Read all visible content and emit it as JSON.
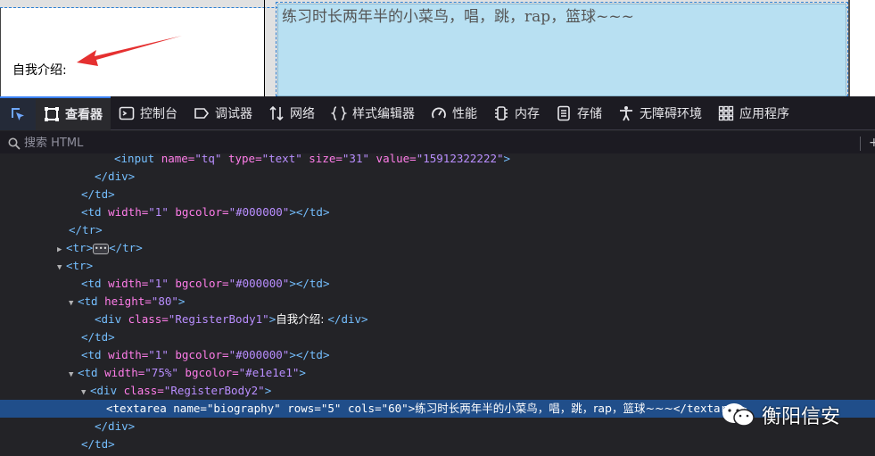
{
  "preview": {
    "intro_label": "自我介绍:",
    "textarea_value": "练习时长两年半的小菜鸟，唱，跳，rap，篮球~~~"
  },
  "toolbar": {
    "tabs": [
      {
        "label": "查看器",
        "icon": "inspector-icon",
        "active": true
      },
      {
        "label": "控制台",
        "icon": "console-icon"
      },
      {
        "label": "调试器",
        "icon": "debugger-icon"
      },
      {
        "label": "网络",
        "icon": "network-icon"
      },
      {
        "label": "样式编辑器",
        "icon": "style-editor-icon"
      },
      {
        "label": "性能",
        "icon": "performance-icon"
      },
      {
        "label": "内存",
        "icon": "memory-icon"
      },
      {
        "label": "存储",
        "icon": "storage-icon"
      },
      {
        "label": "无障碍环境",
        "icon": "accessibility-icon"
      },
      {
        "label": "应用程序",
        "icon": "application-icon"
      }
    ]
  },
  "search": {
    "placeholder": "搜索 HTML"
  },
  "tree": {
    "l0": {
      "tag_open": "<input ",
      "attr1": "name=",
      "val1": "\"tq\"",
      "attr2": " type=",
      "val2": "\"text\"",
      "attr3": " size=",
      "val3": "\"31\"",
      "attr4": " value=",
      "val4": "\"15912322222\"",
      "tag_close": ">"
    },
    "l1": {
      "tag": "</div>"
    },
    "l2": {
      "tag": "</td>"
    },
    "l3": {
      "tag_open": "<td ",
      "attr1": "width=",
      "val1": "\"1\"",
      "attr2": " bgcolor=",
      "val2": "\"#000000\"",
      "tag_close": "></td>"
    },
    "l4": {
      "tag": "</tr>"
    },
    "l5": {
      "tag_open": "<tr>",
      "tag_close": "</tr>"
    },
    "l6": {
      "tag": "<tr>"
    },
    "l7": {
      "tag_open": "<td ",
      "attr1": "width=",
      "val1": "\"1\"",
      "attr2": " bgcolor=",
      "val2": "\"#000000\"",
      "tag_close": "></td>"
    },
    "l8": {
      "tag_open": "<td ",
      "attr1": "height=",
      "val1": "\"80\"",
      "tag_close": ">"
    },
    "l9": {
      "tag_open": "<div ",
      "attr1": "class=",
      "val1": "\"RegisterBody1\"",
      "tag_mid": ">",
      "text": "自我介绍: ",
      "tag_close": "</div>"
    },
    "l10": {
      "tag": "</td>"
    },
    "l11": {
      "tag_open": "<td ",
      "attr1": "width=",
      "val1": "\"1\"",
      "attr2": " bgcolor=",
      "val2": "\"#000000\"",
      "tag_close": "></td>"
    },
    "l12": {
      "tag_open": "<td ",
      "attr1": "width=",
      "val1": "\"75%\"",
      "attr2": " bgcolor=",
      "val2": "\"#e1e1e1\"",
      "tag_close": ">"
    },
    "l13": {
      "tag_open": "<div ",
      "attr1": "class=",
      "val1": "\"RegisterBody2\"",
      "tag_close": ">"
    },
    "l14": {
      "tag_open": "<textarea ",
      "attr1": "name=",
      "val1": "\"biography\"",
      "attr2": " rows=",
      "val2": "\"5\"",
      "attr3": " cols=",
      "val3": "\"60\"",
      "tag_mid": ">",
      "text": "练习时长两年半的小菜鸟，唱，跳，rap，篮球~~~",
      "tag_close": "</textarea>"
    },
    "l15": {
      "tag": "</div>"
    },
    "l16": {
      "tag": "</td>"
    }
  },
  "watermark": {
    "text": "衡阳信安"
  },
  "colors": {
    "accent": "#3b82f6",
    "selected_row": "#204e8a",
    "tag": "#75bfff",
    "attr": "#ff7de9",
    "value": "#b98eff"
  }
}
